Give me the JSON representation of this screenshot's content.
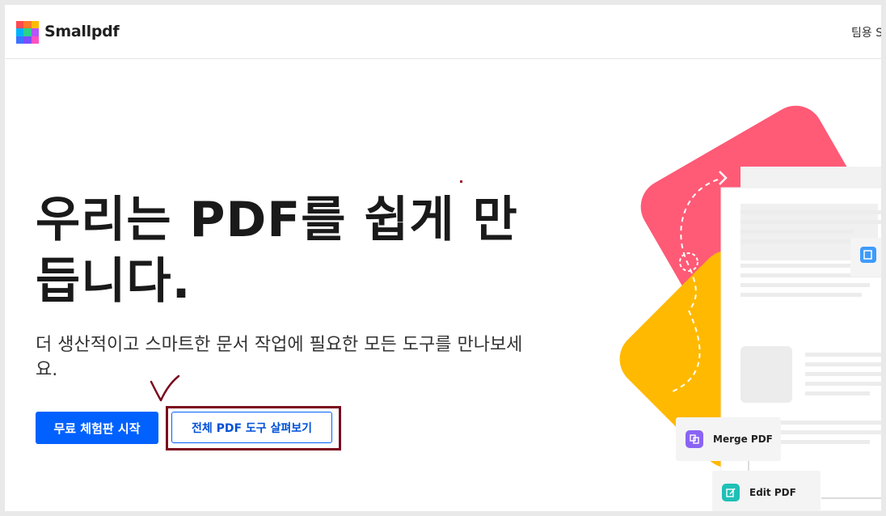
{
  "header": {
    "brand": "Smallpdf",
    "nav_teams": "팀용 S"
  },
  "hero": {
    "title": "우리는 PDF를 쉽게 만듭니다.",
    "subtitle": "더 생산적이고 스마트한 문서 작업에 필요한 모든 도구를 만나보세요.",
    "primary_cta": "무료 체험판 시작",
    "secondary_cta": "전체 PDF 도구 살펴보기"
  },
  "illustration": {
    "merge_label": "Merge PDF",
    "edit_label": "Edit PDF"
  },
  "colors": {
    "accent": "#0061fe",
    "annotation": "#7a0a1e",
    "pink": "#ff5a76",
    "yellow": "#ffb900",
    "merge_icon": "#8a63f5",
    "edit_icon": "#1fc0b6",
    "doc_icon": "#3e9bfb"
  },
  "icons": [
    "smallpdf-logo-icon",
    "merge-icon",
    "edit-icon",
    "document-icon",
    "checkmark-annotation-icon",
    "arrow-icon"
  ]
}
